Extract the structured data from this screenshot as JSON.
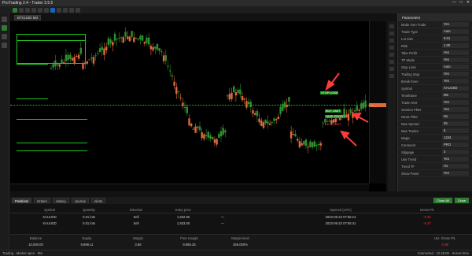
{
  "window": {
    "title": "ProTrading 2.4 - Trader 3.5.5",
    "controls": [
      "—",
      "□",
      "✕"
    ]
  },
  "chart": {
    "tab_label": "BTCUSD 5M",
    "current_price": "—",
    "price_labels": [
      "",
      "",
      "",
      "",
      "",
      "",
      "",
      "",
      "",
      "",
      "",
      "",
      "",
      "",
      "",
      "",
      ""
    ],
    "time_labels": [
      "",
      "",
      "",
      "",
      "",
      "",
      "",
      "",
      ""
    ]
  },
  "annotations": {
    "stop_label": "STOP LOSS",
    "entry_label": "BUY LIMIT",
    "target_label": "TAKE PROFIT",
    "sell_label": "SELL LIMIT"
  },
  "right_panel": {
    "title": "Parameters",
    "rows": [
      {
        "k": "Mode Gen Trade",
        "v": "Yes"
      },
      {
        "k": "Trade Type",
        "v": "Auto"
      },
      {
        "k": "Lot Size",
        "v": "0.01"
      },
      {
        "k": "Risk",
        "v": "1.00"
      },
      {
        "k": "Take Profit",
        "v": "Yes"
      },
      {
        "k": "TP Mode",
        "v": "Yes"
      },
      {
        "k": "Stop Loss",
        "v": "Auto"
      },
      {
        "k": "Trailing Stop",
        "v": "Yes"
      },
      {
        "k": "Break Even",
        "v": "Yes"
      },
      {
        "k": "Symbol",
        "v": "XAUUSD"
      },
      {
        "k": "Timeframe",
        "v": "M5"
      },
      {
        "k": "Trade Alert",
        "v": "Yes"
      },
      {
        "k": "Session Filter",
        "v": "Yes"
      },
      {
        "k": "News Filter",
        "v": "No"
      },
      {
        "k": "Max Spread",
        "v": "25"
      },
      {
        "k": "Max Trades",
        "v": "5"
      },
      {
        "k": "Magic",
        "v": "1234"
      },
      {
        "k": "Comment",
        "v": "PRO"
      },
      {
        "k": "Slippage",
        "v": "3"
      },
      {
        "k": "Use Trend",
        "v": "Yes"
      },
      {
        "k": "Trend TF",
        "v": "H1"
      },
      {
        "k": "Show Panel",
        "v": "Yes"
      }
    ]
  },
  "bottom_tabs": {
    "items": [
      "Positions",
      "Orders",
      "History",
      "Journal",
      "Alerts"
    ],
    "active": "Positions",
    "right_buttons": [
      "Close All",
      "Close"
    ]
  },
  "positions": {
    "headers": [
      "",
      "Symbol",
      "Quantity",
      "Direction",
      "Entry price",
      "",
      "",
      "",
      "Opened (UTC)",
      "",
      "Gross P/L",
      ""
    ],
    "rows": [
      [
        "",
        "XAUUSD",
        "0.01 lots",
        "Sell",
        "1,932.95",
        "—",
        "",
        "",
        "2023-05-23 07:56:14",
        "",
        "-0.42",
        ""
      ],
      [
        "",
        "XAUUSD",
        "0.01 lots",
        "Sell",
        "1,933.00",
        "—",
        "",
        "",
        "2023-05-23 07:55:41",
        "",
        "-0.47",
        ""
      ]
    ]
  },
  "account": {
    "headers": [
      "Balance",
      "Equity",
      "Margin",
      "Free margin",
      "Margin level",
      "",
      "",
      "",
      "Unr. Gross P/L"
    ],
    "row": [
      "10,000.00",
      "9,999.11",
      "3.86",
      "9,995.25",
      "259,000%",
      "",
      "",
      "",
      "-0.89"
    ]
  },
  "status": {
    "left": "Trading · Market open · 5M",
    "right": "Connected · 12:45:08 · Server time"
  },
  "colors": {
    "up": "#e06a3a",
    "down": "#2f8f2f",
    "accent": "#1ec81e",
    "marker": "#ff3b3b"
  }
}
